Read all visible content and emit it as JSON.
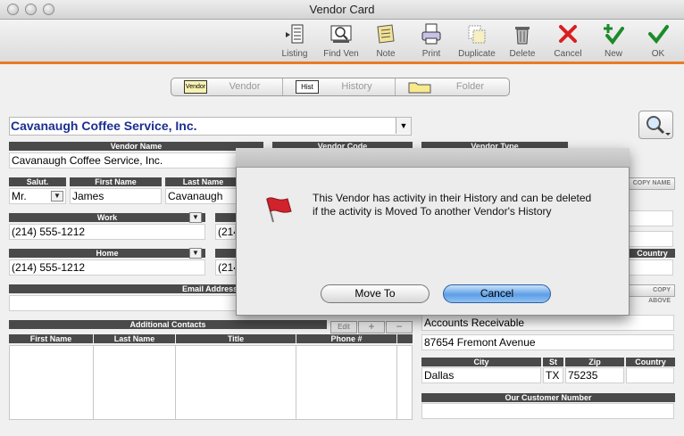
{
  "window": {
    "title": "Vendor Card"
  },
  "toolbar": {
    "items": [
      {
        "label": "Listing",
        "icon": "listing-icon"
      },
      {
        "label": "Find Ven",
        "icon": "find-vendor-icon"
      },
      {
        "label": "Note",
        "icon": "note-icon"
      },
      {
        "label": "Print",
        "icon": "print-icon"
      },
      {
        "label": "Duplicate",
        "icon": "duplicate-icon"
      },
      {
        "label": "Delete",
        "icon": "trash-icon"
      },
      {
        "label": "Cancel",
        "icon": "red-x-icon"
      },
      {
        "label": "New",
        "icon": "green-plus-check-icon"
      },
      {
        "label": "OK",
        "icon": "green-check-icon"
      }
    ]
  },
  "tabs": [
    {
      "label": "Vendor",
      "icon_text": "Vendor"
    },
    {
      "label": "History",
      "icon_text": "Hist"
    },
    {
      "label": "Folder",
      "icon": "folder-icon"
    }
  ],
  "vendor": {
    "title": "Cavanaugh Coffee Service, Inc.",
    "name_header": "Vendor Name",
    "name": "Cavanaugh Coffee Service, Inc.",
    "code_header": "Vendor Code",
    "type_header": "Vendor Type",
    "salut_header": "Salut.",
    "salut": "Mr.",
    "first_name_header": "First Name",
    "first_name": "James",
    "last_name_header": "Last Name",
    "last_name": "Cavanaugh",
    "copy_name_label": "Copy Name",
    "work_header": "Work",
    "work_phone": "(214) 555-1212",
    "work_phone2_partial": "(214",
    "home_header": "Home",
    "home_phone": "(214) 555-1212",
    "home_phone2_partial": "(214",
    "email_header": "Email Address",
    "country_header": "Country",
    "copy_above_label": "Copy Above"
  },
  "address": {
    "line1": "Accounts Receivable",
    "line2": "87654 Fremont Avenue",
    "city_header": "City",
    "st_header": "St",
    "zip_header": "Zip",
    "country_header": "Country",
    "city": "Dallas",
    "st": "TX",
    "zip": "75235",
    "customer_number_header": "Our Customer Number"
  },
  "contacts": {
    "header": "Additional Contacts",
    "edit_label": "Edit",
    "add_label": "+",
    "remove_label": "−",
    "columns": [
      "First Name",
      "Last Name",
      "Title",
      "Phone #"
    ]
  },
  "dialog": {
    "message": "This Vendor has activity in their History and can  be deleted if the activity is Moved To another Vendor's History",
    "move_to_label": "Move To",
    "cancel_label": "Cancel",
    "icon": "red-flag-icon"
  },
  "colors": {
    "accent_orange": "#e87b24",
    "vendor_title_blue": "#1c2f8f",
    "default_button_blue": "#5e9ee6"
  }
}
